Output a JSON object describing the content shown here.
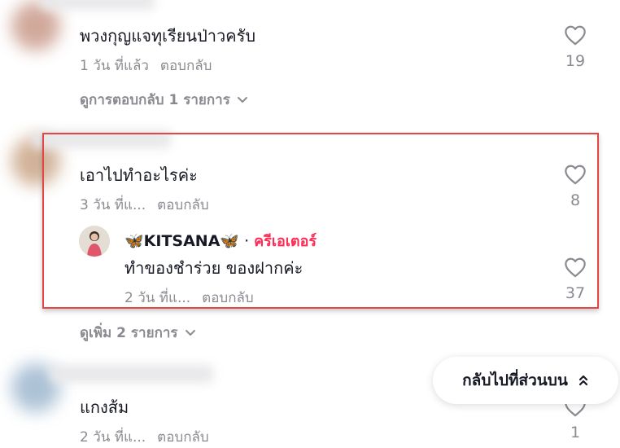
{
  "comments": [
    {
      "text": "พวงกุญแจทุเรียนป่าวครับ",
      "time": "1 วัน ที่แล้ว",
      "reply": "ตอบกลับ",
      "likes": "19",
      "view_replies": "ดูการตอบกลับ 1 รายการ"
    },
    {
      "text": "เอาไปทำอะไรค่ะ",
      "time": "3 วัน ที่แ...",
      "reply": "ตอบกลับ",
      "likes": "8",
      "view_more": "ดูเพิ่ม 2 รายการ",
      "creator_reply": {
        "name": "🦋KITSANA🦋",
        "separator": "·",
        "tag": "ครีเอเตอร์",
        "text": "ทำของชำร่วย ของฝากค่ะ",
        "time": "2 วัน ที่แ...",
        "reply": "ตอบกลับ",
        "likes": "37"
      }
    },
    {
      "text": "แกงส้ม",
      "time": "2 วัน ที่แ...",
      "reply": "ตอบกลับ",
      "likes": "1"
    }
  ],
  "back_to_top": {
    "label": "กลับไปที่ส่วนบน",
    "icon": "double-chevron-up-icon"
  },
  "colors": {
    "highlight": "#e54545",
    "creator": "#fe2c55",
    "muted": "#8a8b91"
  }
}
